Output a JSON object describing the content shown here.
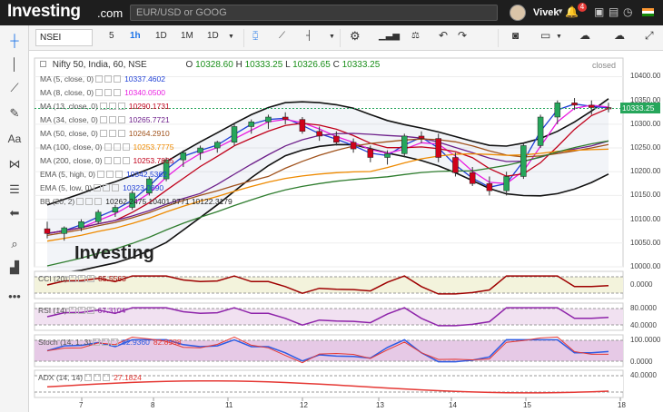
{
  "topbar": {
    "logo": "Investing",
    "logo_suffix": ".com",
    "search_placeholder": "EUR/USD or GOOG",
    "user_name": "Vivek",
    "notification_count": "4",
    "icons": [
      "bell-icon",
      "briefcase-icon",
      "trash-icon",
      "clock-icon",
      "india-flag-icon"
    ]
  },
  "toolbar": {
    "symbol": "NSEI",
    "intervals": [
      "5",
      "1h",
      "1D",
      "1M",
      "1D"
    ],
    "active_interval": "1h",
    "icons": [
      "candles-icon",
      "line-chart-icon",
      "bar-style-icon",
      "settings-icon",
      "indicators-icon",
      "compare-icon",
      "undo-icon",
      "redo-icon",
      "camera-icon",
      "color-icon",
      "cloud-download-icon",
      "cloud-upload-icon",
      "fullscreen-icon"
    ]
  },
  "left_tools": [
    "crosshair-icon",
    "vertical-line-icon",
    "trend-line-icon",
    "brush-icon",
    "text-icon",
    "pattern-icon",
    "fib-icon",
    "back-arrow-icon",
    "zoom-icon",
    "measure-icon",
    "more-icon"
  ],
  "header": {
    "title": "Nifty 50, India, 60, NSE",
    "open_label": "O",
    "open": "10328.60",
    "high_label": "H",
    "high": "10333.25",
    "low_label": "L",
    "low": "10326.65",
    "close_label": "C",
    "close": "10333.25",
    "status": "closed",
    "last_price": "10333.25"
  },
  "legend": [
    {
      "name": "MA (5, close, 0)",
      "value": "10337.4602",
      "color": "#1f3fd6"
    },
    {
      "name": "MA (8, close, 0)",
      "value": "10340.0500",
      "color": "#e91ee0"
    },
    {
      "name": "MA (13, close, 0)",
      "value": "10290.1731",
      "color": "#c0001a"
    },
    {
      "name": "MA (34, close, 0)",
      "value": "10265.7721",
      "color": "#6d1f8a"
    },
    {
      "name": "MA (50, close, 0)",
      "value": "10264.2910",
      "color": "#a0521c"
    },
    {
      "name": "MA (100, close, 0)",
      "value": "10253.7775",
      "color": "#ee8a00"
    },
    {
      "name": "MA (200, close, 0)",
      "value": "10253.7805",
      "color": "#c0001a"
    },
    {
      "name": "EMA (5, high, 0)",
      "value": "10342.5362",
      "color": "#1f3fd6"
    },
    {
      "name": "EMA (5, low, 0)",
      "value": "10323.0890",
      "color": "#1f3fd6"
    },
    {
      "name": "BB (20, 2)",
      "value": "10262.2475 10401.9771 10122.3179",
      "color": "#222"
    }
  ],
  "watermark": "Investing",
  "y_axis": [
    "10400.00",
    "10350.00",
    "10300.00",
    "10250.00",
    "10200.00",
    "10150.00",
    "10100.00",
    "10050.00",
    "10000.00"
  ],
  "x_axis": [
    "7",
    "8",
    "11",
    "12",
    "13",
    "14",
    "15",
    "18"
  ],
  "indicators": [
    {
      "name": "CCI (20)",
      "value": "85.5563",
      "color": "#9e0000",
      "levels": [
        "0.0000"
      ]
    },
    {
      "name": "RSI (14)",
      "value": "67.3104",
      "color": "#8e24aa",
      "levels": [
        "80.0000",
        "40.0000"
      ]
    },
    {
      "name": "Stoch (14, 1, 3)",
      "value": "82.9360",
      "value2": "82.8998",
      "color": "#2d5be3",
      "color2": "#e53935",
      "levels": [
        "100.0000",
        "0.0000"
      ]
    },
    {
      "name": "ADX (14, 14)",
      "value": "27.1824",
      "color": "#e53935",
      "levels": [
        "40.0000"
      ]
    }
  ],
  "chart_data": {
    "type": "candlestick",
    "title": "Nifty 50, India, 60, NSE",
    "x": [
      "7",
      "8",
      "11",
      "12",
      "13",
      "14",
      "15",
      "18"
    ],
    "ylim": [
      10000,
      10420
    ],
    "candles": [
      [
        10080,
        10095,
        10060,
        10070
      ],
      [
        10070,
        10085,
        10055,
        10082
      ],
      [
        10082,
        10100,
        10075,
        10095
      ],
      [
        10095,
        10120,
        10090,
        10115
      ],
      [
        10115,
        10130,
        10105,
        10125
      ],
      [
        10125,
        10160,
        10120,
        10155
      ],
      [
        10155,
        10190,
        10150,
        10185
      ],
      [
        10185,
        10230,
        10180,
        10225
      ],
      [
        10225,
        10245,
        10210,
        10240
      ],
      [
        10240,
        10255,
        10225,
        10250
      ],
      [
        10250,
        10265,
        10240,
        10262
      ],
      [
        10262,
        10300,
        10255,
        10295
      ],
      [
        10295,
        10310,
        10280,
        10305
      ],
      [
        10305,
        10320,
        10290,
        10315
      ],
      [
        10315,
        10325,
        10300,
        10310
      ],
      [
        10310,
        10315,
        10280,
        10285
      ],
      [
        10285,
        10295,
        10265,
        10275
      ],
      [
        10275,
        10285,
        10255,
        10262
      ],
      [
        10262,
        10270,
        10240,
        10248
      ],
      [
        10248,
        10255,
        10220,
        10230
      ],
      [
        10230,
        10245,
        10215,
        10238
      ],
      [
        10238,
        10280,
        10230,
        10275
      ],
      [
        10275,
        10285,
        10260,
        10270
      ],
      [
        10270,
        10280,
        10220,
        10230
      ],
      [
        10230,
        10240,
        10190,
        10198
      ],
      [
        10198,
        10210,
        10170,
        10175
      ],
      [
        10175,
        10190,
        10150,
        10160
      ],
      [
        10160,
        10200,
        10150,
        10190
      ],
      [
        10190,
        10260,
        10185,
        10255
      ],
      [
        10255,
        10320,
        10250,
        10315
      ],
      [
        10315,
        10350,
        10300,
        10345
      ],
      [
        10345,
        10355,
        10330,
        10340
      ],
      [
        10340,
        10350,
        10320,
        10335
      ],
      [
        10335,
        10345,
        10325,
        10333
      ]
    ],
    "bb": {
      "upper_end": 10401.98,
      "lower_end": 10122.32,
      "mid_end": 10262.25
    }
  }
}
